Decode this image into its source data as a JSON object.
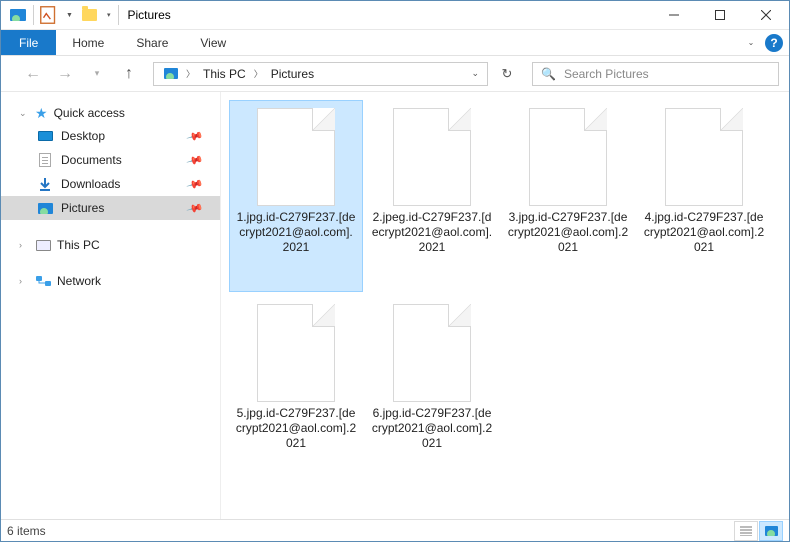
{
  "titlebar": {
    "title": "Pictures"
  },
  "ribbon": {
    "file": "File",
    "tabs": [
      "Home",
      "Share",
      "View"
    ]
  },
  "breadcrumb": {
    "items": [
      "This PC",
      "Pictures"
    ]
  },
  "search": {
    "placeholder": "Search Pictures"
  },
  "sidebar": {
    "quickaccess": "Quick access",
    "pinned": [
      "Desktop",
      "Documents",
      "Downloads",
      "Pictures"
    ],
    "selected_index": 3,
    "thispc": "This PC",
    "network": "Network"
  },
  "files": [
    {
      "name": "1.jpg.id-C279F237.[decrypt2021@aol.com].2021",
      "selected": true
    },
    {
      "name": "2.jpeg.id-C279F237.[decrypt2021@aol.com].2021",
      "selected": false
    },
    {
      "name": "3.jpg.id-C279F237.[decrypt2021@aol.com].2021",
      "selected": false
    },
    {
      "name": "4.jpg.id-C279F237.[decrypt2021@aol.com].2021",
      "selected": false
    },
    {
      "name": "5.jpg.id-C279F237.[decrypt2021@aol.com].2021",
      "selected": false
    },
    {
      "name": "6.jpg.id-C279F237.[decrypt2021@aol.com].2021",
      "selected": false
    }
  ],
  "statusbar": {
    "text": "6 items"
  }
}
